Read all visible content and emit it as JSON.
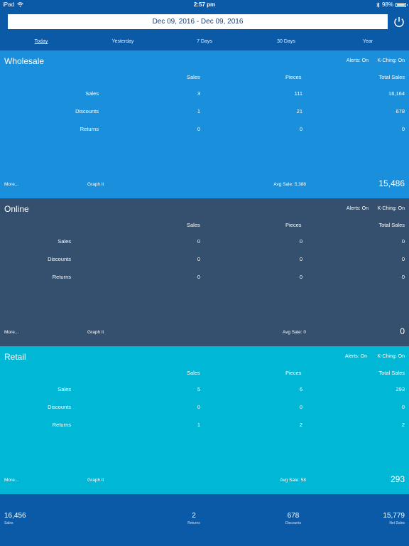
{
  "status_bar": {
    "device": "iPad",
    "time": "2:57 pm",
    "battery": "98%",
    "battery_level": 0.98
  },
  "header": {
    "date_range": "Dec 09, 2016  -  Dec 09, 2016"
  },
  "tabs": [
    {
      "label": "Today",
      "active": true
    },
    {
      "label": "Yesterday",
      "active": false
    },
    {
      "label": "7 Days",
      "active": false
    },
    {
      "label": "30 Days",
      "active": false
    },
    {
      "label": "Year",
      "active": false
    }
  ],
  "column_headers": {
    "sales": "Sales",
    "pieces": "Pieces",
    "total_sales": "Total Sales"
  },
  "sections": [
    {
      "title": "Wholesale",
      "alerts": "Alerts: On",
      "kching": "K-Ching: On",
      "color": "#1a8fdb",
      "rows": [
        {
          "label": "Sales",
          "sales": "3",
          "pieces": "111",
          "total": "16,164"
        },
        {
          "label": "Discounts",
          "sales": "1",
          "pieces": "21",
          "total": "678"
        },
        {
          "label": "Returns",
          "sales": "0",
          "pieces": "0",
          "total": "0"
        }
      ],
      "more": "More...",
      "graph": "Graph it",
      "avg": "Avg Sale: 5,388",
      "net": "15,486"
    },
    {
      "title": "Online",
      "alerts": "Alerts: On",
      "kching": "K-Ching: On",
      "color": "#34506e",
      "rows": [
        {
          "label": "Sales",
          "sales": "0",
          "pieces": "0",
          "total": "0"
        },
        {
          "label": "Discounts",
          "sales": "0",
          "pieces": "0",
          "total": "0"
        },
        {
          "label": "Returns",
          "sales": "0",
          "pieces": "0",
          "total": "0"
        }
      ],
      "more": "More...",
      "graph": "Graph it",
      "avg": "Avg Sale: 0",
      "net": "0"
    },
    {
      "title": "Retail",
      "alerts": "Alerts: On",
      "kching": "K-Ching: On",
      "color": "#00b7d6",
      "rows": [
        {
          "label": "Sales",
          "sales": "5",
          "pieces": "6",
          "total": "293"
        },
        {
          "label": "Discounts",
          "sales": "0",
          "pieces": "0",
          "total": "0"
        },
        {
          "label": "Returns",
          "sales": "1",
          "pieces": "2",
          "total": "2"
        }
      ],
      "more": "More...",
      "graph": "Graph it",
      "avg": "Avg Sale: 58",
      "net": "293"
    }
  ],
  "footer": [
    {
      "value": "16,456",
      "label": "Sales"
    },
    {
      "value": "2",
      "label": "Returns"
    },
    {
      "value": "678",
      "label": "Discounts"
    },
    {
      "value": "15,779",
      "label": "Net Sales"
    }
  ],
  "colors": {
    "header_bg": "#0a5aa8",
    "date_text": "#1a3f6e"
  }
}
